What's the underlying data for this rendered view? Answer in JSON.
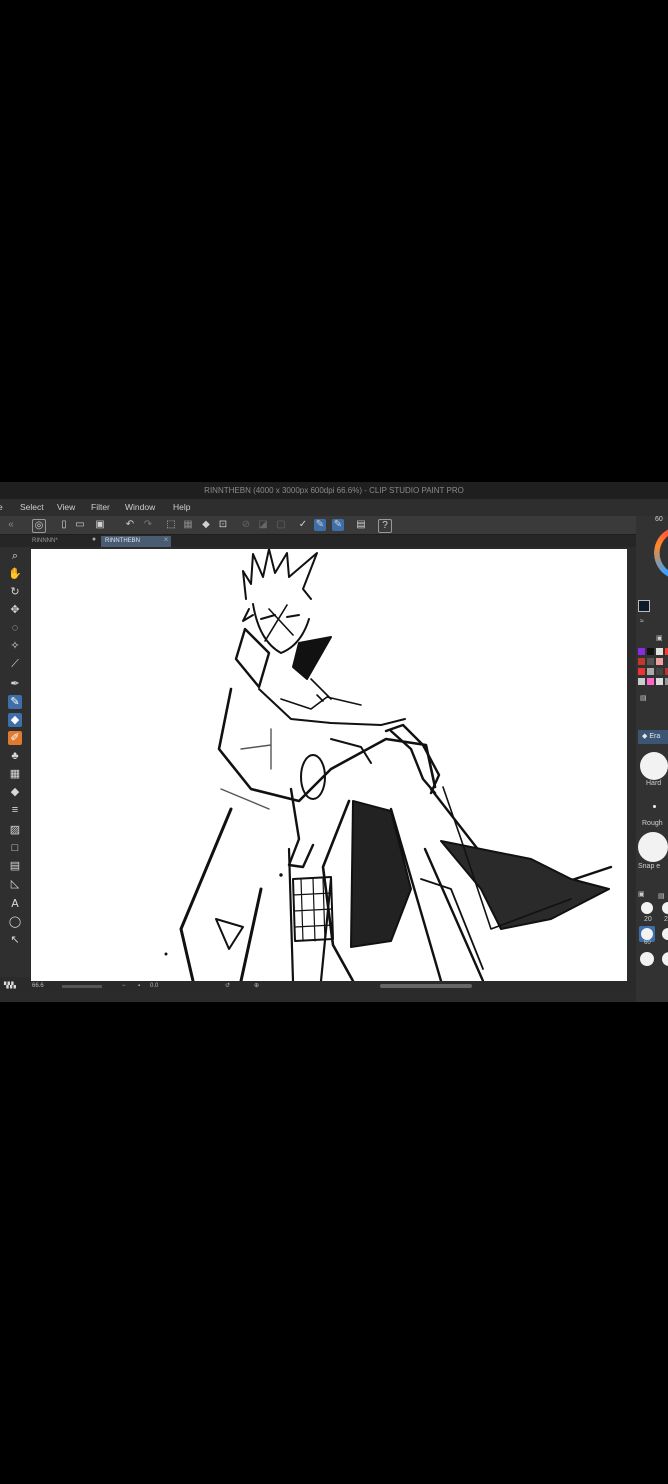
{
  "window": {
    "title": "RINNTHEBN (4000 x 3000px 600dpi 66.6%) - CLIP STUDIO PAINT PRO"
  },
  "menu": {
    "items": [
      "e",
      "Select",
      "View",
      "Filter",
      "Window",
      "Help"
    ]
  },
  "tabs": [
    {
      "label": "RINNNN*",
      "active": false
    },
    {
      "label": "RINNTHEBN",
      "active": true
    }
  ],
  "toolbox": {
    "tools": [
      {
        "name": "zoom-tool",
        "icon": "magnifier-icon"
      },
      {
        "name": "move-tool",
        "icon": "hand-icon"
      },
      {
        "name": "rotate-tool",
        "icon": "rotate-icon"
      },
      {
        "name": "object-tool",
        "icon": "move-arrows-icon"
      },
      {
        "name": "lasso-tool",
        "icon": "lasso-icon"
      },
      {
        "name": "magic-wand-tool",
        "icon": "magic-wand-icon"
      },
      {
        "name": "eyedropper-tool",
        "icon": "eyedropper-icon"
      },
      {
        "name": "pen-tool",
        "icon": "pen-icon"
      },
      {
        "name": "pencil-tool",
        "icon": "pencil-icon"
      },
      {
        "name": "brush-tool",
        "icon": "brush-icon"
      },
      {
        "name": "eraser-tool",
        "icon": "eraser-icon"
      },
      {
        "name": "decoration-tool",
        "icon": "stamp-icon"
      },
      {
        "name": "airbrush-tool",
        "icon": "airbrush-icon"
      },
      {
        "name": "fill-tool",
        "icon": "bucket-icon"
      },
      {
        "name": "hatching-tool",
        "icon": "lines-icon"
      },
      {
        "name": "gradient-tool",
        "icon": "gradient-icon"
      },
      {
        "name": "figure-tool",
        "icon": "square-icon"
      },
      {
        "name": "frame-tool",
        "icon": "frame-icon"
      },
      {
        "name": "ruler-tool",
        "icon": "ruler-icon"
      },
      {
        "name": "text-tool",
        "icon": "text-icon"
      },
      {
        "name": "balloon-tool",
        "icon": "balloon-icon"
      },
      {
        "name": "correct-line-tool",
        "icon": "arrow-select-icon"
      }
    ]
  },
  "status": {
    "zoom": "66.6",
    "angle": "0.0"
  },
  "right_panel": {
    "tab_number": "60",
    "brush_tab": "Era",
    "brush_names": [
      "Hard",
      "Rough",
      "Snap e"
    ],
    "sizes": [
      "20",
      "2"
    ],
    "active_size": "60"
  },
  "colors": {
    "ui_dark": "#2b2b2b",
    "accent_tool": "#e07a2e",
    "tab_active": "#4a5c72"
  }
}
